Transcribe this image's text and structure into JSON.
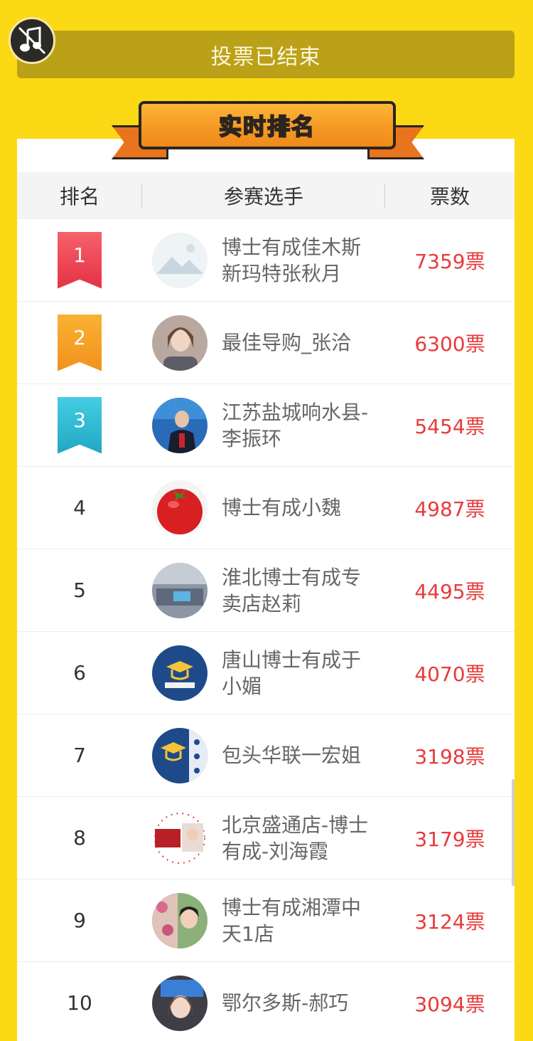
{
  "header": {
    "status_label": "投票已结束",
    "banner_title": "实时排名",
    "music_icon": "music-off-icon"
  },
  "table": {
    "columns": [
      "排名",
      "参赛选手",
      "票数"
    ],
    "rows": [
      {
        "rank": "1",
        "name": "博士有成佳木斯新玛特张秋月",
        "votes": "7359票",
        "badge": "red"
      },
      {
        "rank": "2",
        "name": "最佳导购_张洽",
        "votes": "6300票",
        "badge": "gold"
      },
      {
        "rank": "3",
        "name": "江苏盐城响水县-李振环",
        "votes": "5454票",
        "badge": "blue"
      },
      {
        "rank": "4",
        "name": "博士有成小魏",
        "votes": "4987票"
      },
      {
        "rank": "5",
        "name": "淮北博士有成专卖店赵莉",
        "votes": "4495票"
      },
      {
        "rank": "6",
        "name": "唐山博士有成于小媚",
        "votes": "4070票"
      },
      {
        "rank": "7",
        "name": "包头华联一宏姐",
        "votes": "3198票"
      },
      {
        "rank": "8",
        "name": "北京盛通店-博士有成-刘海霞",
        "votes": "3179票"
      },
      {
        "rank": "9",
        "name": "博士有成湘潭中天1店",
        "votes": "3124票"
      },
      {
        "rank": "10",
        "name": "鄂尔多斯-郝巧",
        "votes": "3094票"
      }
    ]
  },
  "colors": {
    "background": "#fbd914",
    "status_bar": "#bba117",
    "vote_text": "#e83a3a"
  }
}
